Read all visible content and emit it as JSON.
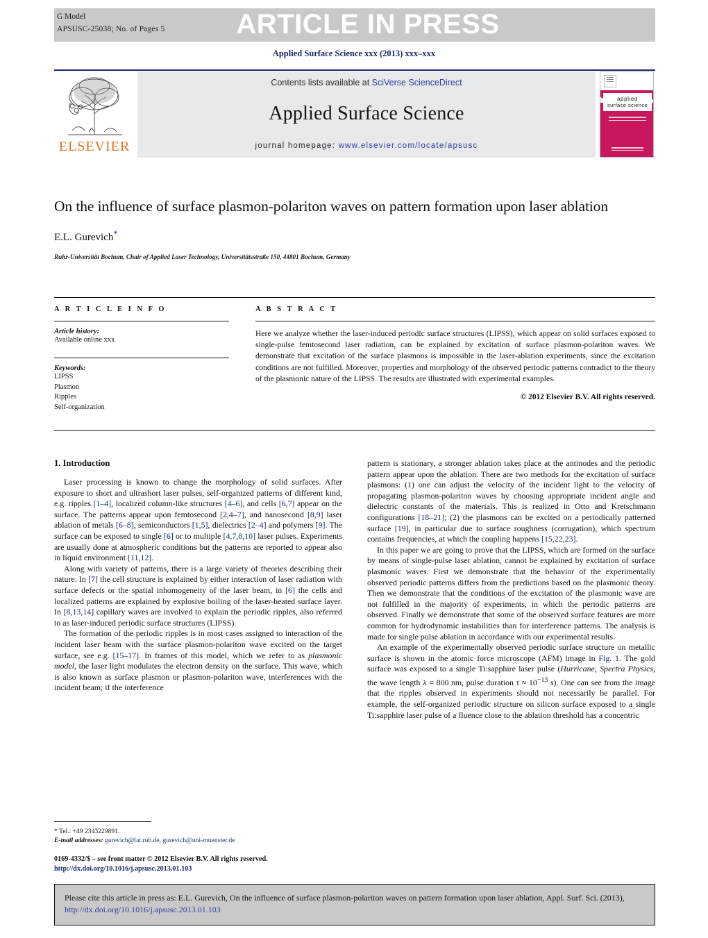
{
  "header": {
    "g_model": "G Model",
    "article_id": "APSUSC-25038;   No. of Pages 5",
    "banner": "ARTICLE IN PRESS",
    "journal_ref": "Applied Surface Science xxx (2013) xxx–xxx"
  },
  "masthead": {
    "contents_prefix": "Contents lists available at ",
    "sciencedirect": "SciVerse ScienceDirect",
    "journal_title": "Applied Surface Science",
    "homepage_label": "journal homepage:",
    "homepage_url": "www.elsevier.com/locate/apsusc",
    "publisher": "ELSEVIER",
    "cover_title_line1": "applied",
    "cover_title_line2": "surface science"
  },
  "article": {
    "title": "On the influence of surface plasmon-polariton waves on pattern formation upon laser ablation",
    "author": "E.L. Gurevich",
    "author_marker": "*",
    "affiliation": "Ruhr-Universität Bochum, Chair of Applied Laser Technology, Universitätsstraße 150, 44801 Bochum, Germany"
  },
  "info": {
    "heading": "A R T I C L E   I N F O",
    "history_label": "Article history:",
    "history_value": "Available online xxx",
    "keywords_label": "Keywords:",
    "keywords": [
      "LIPSS",
      "Plasmon",
      "Ripples",
      "Self-organization"
    ]
  },
  "abstract": {
    "heading": "A B S T R A C T",
    "text": "Here we analyze whether the laser-induced periodic surface structures (LIPSS), which appear on solid surfaces exposed to single-pulse femtosecond laser radiation, can be explained by excitation of surface plasmon-polariton waves. We demonstrate that excitation of the surface plasmons is impossible in the laser-ablation experiments, since the excitation conditions are not fulfilled. Moreover, properties and morphology of the observed periodic patterns contradict to the theory of the plasmonic nature of the LIPSS. The results are illustrated with experimental examples.",
    "copyright": "© 2012 Elsevier B.V. All rights reserved."
  },
  "body": {
    "section_title": "1.  Introduction",
    "left_p1": "Laser processing is known to change the morphology of solid surfaces. After exposure to short and ultrashort laser pulses, self-organized patterns of different kind, e.g. ripples [1–4], localized column-like structures [4–6], and cells [6,7] appear on the surface. The patterns appear upon femtosecond [2,4–7], and nanosecond [8,9] laser ablation of metals [6–8], semiconductors [1,5], dielectrics [2–4] and polymers [9]. The surface can be exposed to single [6] or to multiple [4,7,8,10] laser pulses. Experiments are usually done at atmospheric conditions but the patterns are reported to appear also in liquid environment [11,12].",
    "left_p2": "Along with variety of patterns, there is a large variety of theories describing their nature. In [7] the cell structure is explained by either interaction of laser radiation with surface defects or the spatial inhomogeneity of the laser beam, in [6] the cells and localized patterns are explained by explosive boiling of the laser-heated surface layer. In [8,13,14] capillary waves are involved to explain the periodic ripples, also referred to as laser-induced periodic surface structures (LIPSS).",
    "left_p3": "The formation of the periodic ripples is in most cases assigned to interaction of the incident laser beam with the surface plasmon-polariton wave excited on the target surface, see e.g. [15–17]. In frames of this model, which we refer to as plasmonic model, the laser light modulates the electron density on the surface. This wave, which is also known as surface plasmon or plasmon-polariton wave, interferences with the incident beam; if the interference",
    "right_p1": "pattern is stationary, a stronger ablation takes place at the antinodes and the periodic pattern appear upon the ablation. There are two methods for the excitation of surface plasmons: (1) one can adjust the velocity of the incident light to the velocity of propagating plasmon-polariton waves by choosing appropriate incident angle and dielectric constants of the materials. This is realized in Otto and Kretschmann configurations [18–21]; (2) the plasmons can be excited on a periodically patterned surface [19], in particular due to surface roughness (corrugation), which spectrum contains frequencies, at which the coupling happens [15,22,23].",
    "right_p2": "In this paper we are going to prove that the LIPSS, which are formed on the surface by means of single-pulse laser ablation, cannot be explained by excitation of surface plasmonic waves. First we demonstrate that the behavior of the experimentally observed periodic patterns differs from the predictions based on the plasmonic theory. Then we demonstrate that the conditions of the excitation of the plasmonic wave are not fulfilled in the majority of experiments, in which the periodic patterns are observed. Finally we demonstrate that some of the observed surface features are more common for hydrodynamic instabilities than for interference patterns. The analysis is made for single pulse ablation in accordance with our experimental results.",
    "right_p3": "An example of the experimentally observed periodic surface structure on metallic surface is shown in the atomic force microscope (AFM) image in Fig. 1. The gold surface was exposed to a single Ti:sapphire laser pulse (Hurricane, Spectra Physics, the wave length λ = 800 nm, pulse duration τ ≈ 10−13 s). One can see from the image that the ripples observed in experiments should not necessarily be parallel. For example, the self-organized periodic structure on silicon surface exposed to a single Ti:sapphire laser pulse of a fluence close to the ablation threshold has a concentric"
  },
  "footnote": {
    "tel": "* Tel.: +49 2343229891.",
    "email_label": "E-mail addresses:",
    "emails": "gurevich@lat.rub.de, gurevich@uni-muenster.de",
    "issn_line": "0169-4332/$ – see front matter © 2012 Elsevier B.V. All rights reserved.",
    "doi": "http://dx.doi.org/10.1016/j.apsusc.2013.01.103"
  },
  "cite_box": {
    "text_prefix": "Please cite this article in press as: E.L. Gurevich, On the influence of surface plasmon-polariton waves on pattern formation upon laser ablation, Appl. Surf. Sci. (2013), ",
    "link": "http://dx.doi.org/10.1016/j.apsusc.2013.01.103"
  },
  "colors": {
    "band_gray": "#c9c9c9",
    "link_blue": "#2b3fa0",
    "ref_blue": "#1b2a6b",
    "elsevier_orange": "#e8711a",
    "cover_magenta": "#c8175c",
    "panel_gray": "#e8e9ea"
  }
}
